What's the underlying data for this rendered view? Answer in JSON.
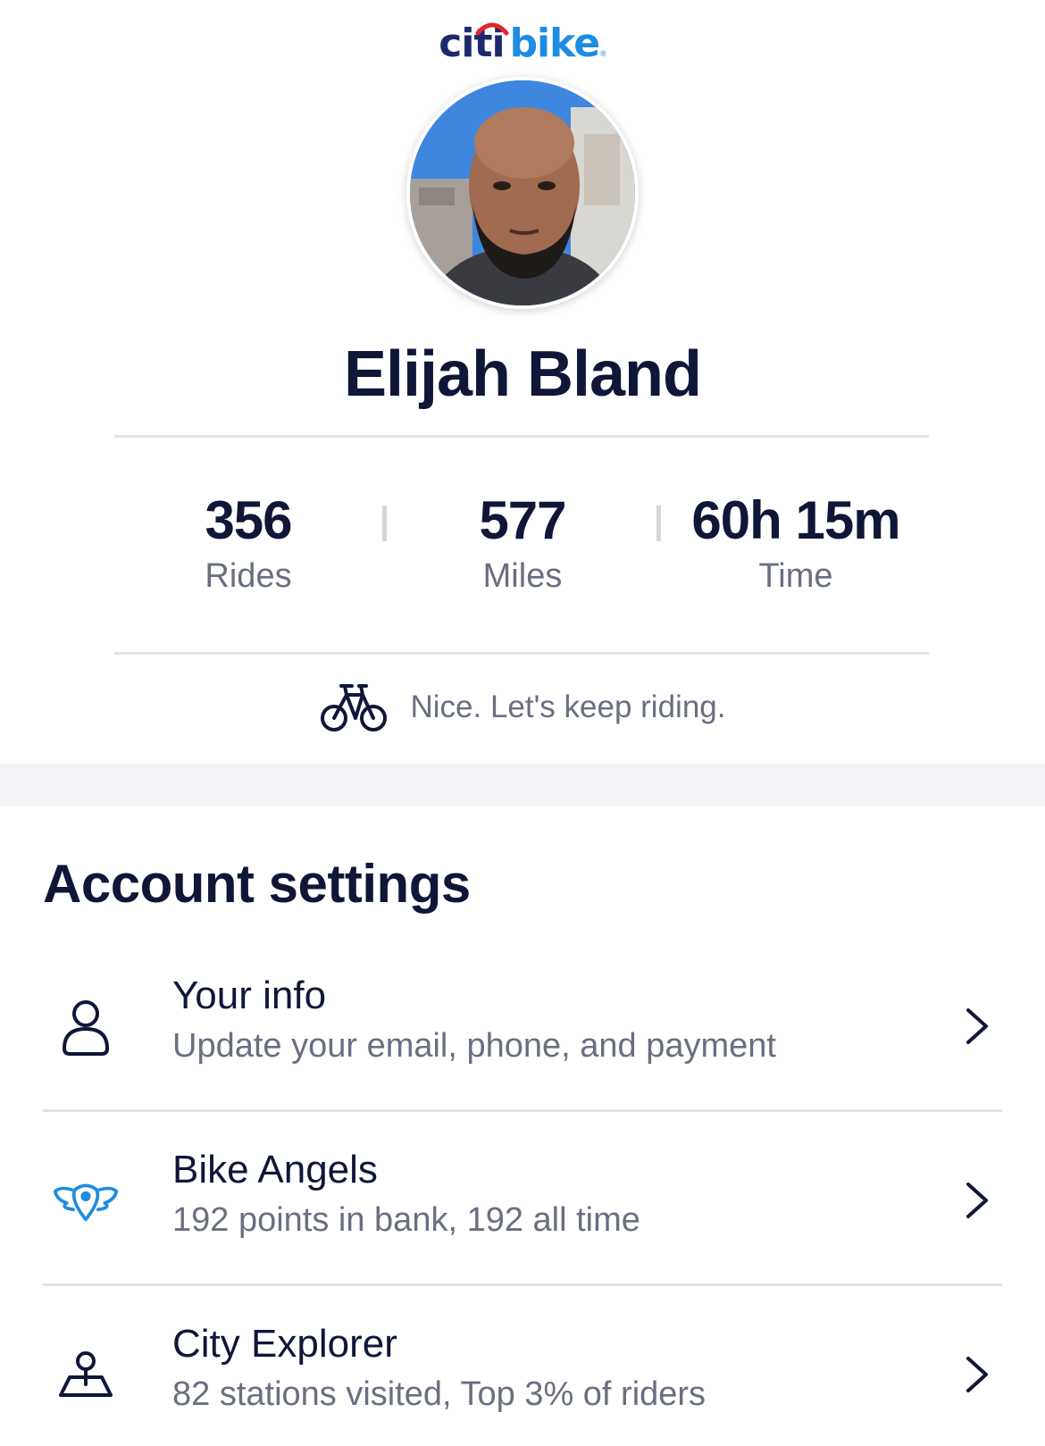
{
  "header": {
    "logo_citi": "citi",
    "logo_bike": "bike",
    "logo_trademark": "®"
  },
  "profile": {
    "avatar_alt": "profile photo",
    "name": "Elijah Bland"
  },
  "stats": [
    {
      "value": "356",
      "label": "Rides"
    },
    {
      "value": "577",
      "label": "Miles"
    },
    {
      "value": "60h 15m",
      "label": "Time"
    }
  ],
  "encouragement": {
    "icon": "bicycle-icon",
    "text": "Nice. Let's keep riding."
  },
  "account_settings": {
    "title": "Account settings",
    "items": [
      {
        "icon": "person-icon",
        "title": "Your info",
        "subtitle": "Update your email, phone, and payment"
      },
      {
        "icon": "bike-angels-icon",
        "title": "Bike Angels",
        "subtitle": "192 points in bank, 192 all time"
      },
      {
        "icon": "city-explorer-pin-icon",
        "title": "City Explorer",
        "subtitle": "82 stations visited, Top 3% of riders"
      }
    ]
  },
  "colors": {
    "navy": "#0f1638",
    "citi_navy": "#1c2a6b",
    "citi_blue": "#1e8ce0",
    "citi_red": "#e3262d",
    "muted_text": "#6a6e82",
    "divider": "#e2e3e6",
    "band": "#f3f4f8"
  }
}
